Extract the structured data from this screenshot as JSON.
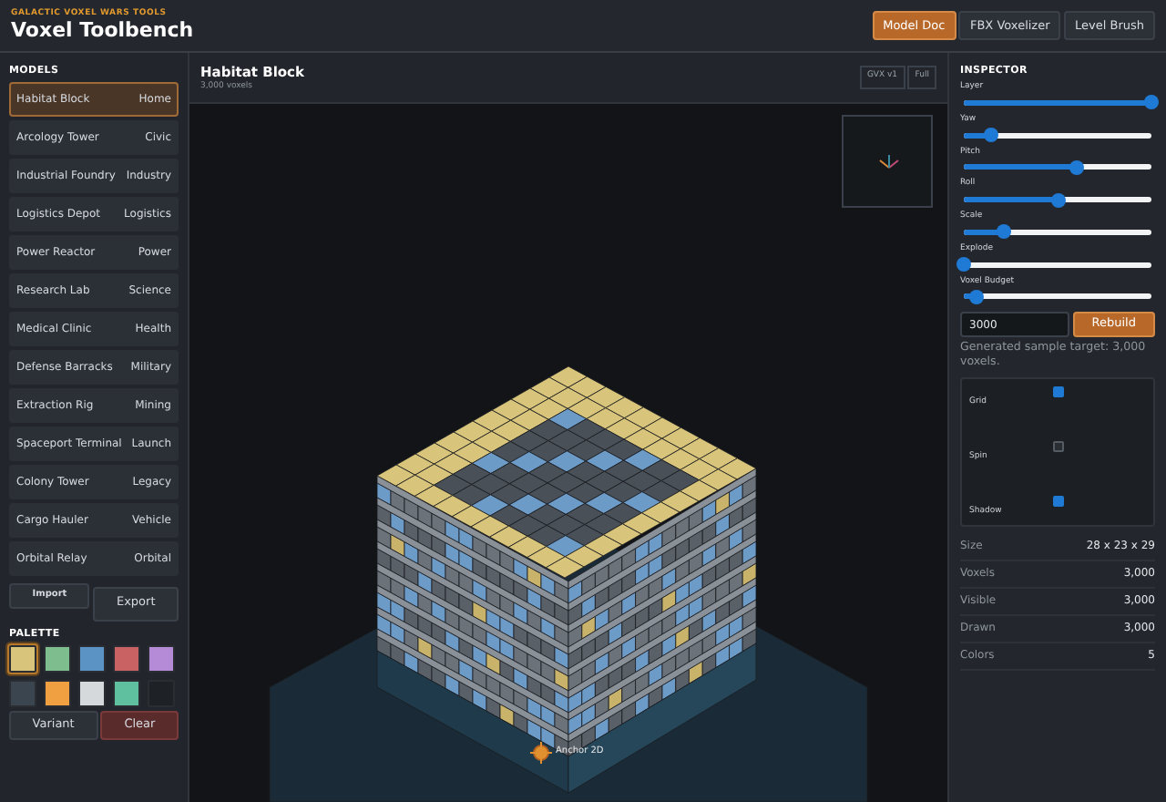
{
  "app": {
    "eyebrow": "GALACTIC VOXEL WARS TOOLS",
    "title": "Voxel Toolbench"
  },
  "top_tabs": [
    {
      "label": "Model Doc",
      "selected": true
    },
    {
      "label": "FBX Voxelizer",
      "selected": false
    },
    {
      "label": "Level Brush",
      "selected": false
    }
  ],
  "models": {
    "heading": "MODELS",
    "items": [
      {
        "name": "Habitat Block",
        "category": "Home",
        "selected": true
      },
      {
        "name": "Arcology Tower",
        "category": "Civic",
        "selected": false
      },
      {
        "name": "Industrial Foundry",
        "category": "Industry",
        "selected": false
      },
      {
        "name": "Logistics Depot",
        "category": "Logistics",
        "selected": false
      },
      {
        "name": "Power Reactor",
        "category": "Power",
        "selected": false
      },
      {
        "name": "Research Lab",
        "category": "Science",
        "selected": false
      },
      {
        "name": "Medical Clinic",
        "category": "Health",
        "selected": false
      },
      {
        "name": "Defense Barracks",
        "category": "Military",
        "selected": false
      },
      {
        "name": "Extraction Rig",
        "category": "Mining",
        "selected": false
      },
      {
        "name": "Spaceport Terminal",
        "category": "Launch",
        "selected": false
      },
      {
        "name": "Colony Tower",
        "category": "Legacy",
        "selected": false
      },
      {
        "name": "Cargo Hauler",
        "category": "Vehicle",
        "selected": false
      },
      {
        "name": "Orbital Relay",
        "category": "Orbital",
        "selected": false
      }
    ]
  },
  "file_buttons": [
    "Import",
    "Export"
  ],
  "palette": {
    "heading": "PALETTE",
    "swatches": [
      {
        "color": "#d8c47a",
        "selected": true
      },
      {
        "color": "#7dbd8e",
        "selected": false
      },
      {
        "color": "#5a93c4",
        "selected": false
      },
      {
        "color": "#c96363",
        "selected": false
      },
      {
        "color": "#b58ad6",
        "selected": false
      },
      {
        "color": "#3a4550",
        "selected": false
      },
      {
        "color": "#f0a040",
        "selected": false
      },
      {
        "color": "#d5d9dc",
        "selected": false
      },
      {
        "color": "#5fc0a0",
        "selected": false
      },
      {
        "color": "#1e2227",
        "selected": false
      }
    ]
  },
  "palette_buttons": [
    {
      "label": "Variant",
      "kind": "neutral"
    },
    {
      "label": "Clear",
      "kind": "danger"
    }
  ],
  "viewport": {
    "title": "Habitat Block",
    "subtitle": "3,000 voxels",
    "badges": [
      "GVX v1",
      "Full"
    ],
    "anchor_label": "Anchor 2D"
  },
  "inspector": {
    "heading": "INSPECTOR",
    "sliders": [
      {
        "label": "Layer",
        "level": 1.0
      },
      {
        "label": "Yaw",
        "level": 0.15
      },
      {
        "label": "Pitch",
        "level": 0.6
      },
      {
        "label": "Roll",
        "level": 0.5
      },
      {
        "label": "Scale",
        "level": 0.21
      },
      {
        "label": "Explode",
        "level": 0.0
      },
      {
        "label": "Voxel Budget",
        "level": 0.07
      }
    ],
    "budget_value": "3000",
    "rebuild": "Rebuild",
    "note": "Generated sample target: 3,000 voxels.",
    "toggles": [
      {
        "label": "Grid",
        "checked": true
      },
      {
        "label": "Spin",
        "checked": false
      },
      {
        "label": "Shadow",
        "checked": true
      }
    ],
    "stats": [
      {
        "label": "Size",
        "value": "28 x 23 x 29"
      },
      {
        "label": "Voxels",
        "value": "3,000"
      },
      {
        "label": "Visible",
        "value": "3,000"
      },
      {
        "label": "Drawn",
        "value": "3,000"
      },
      {
        "label": "Colors",
        "value": "5"
      }
    ]
  }
}
